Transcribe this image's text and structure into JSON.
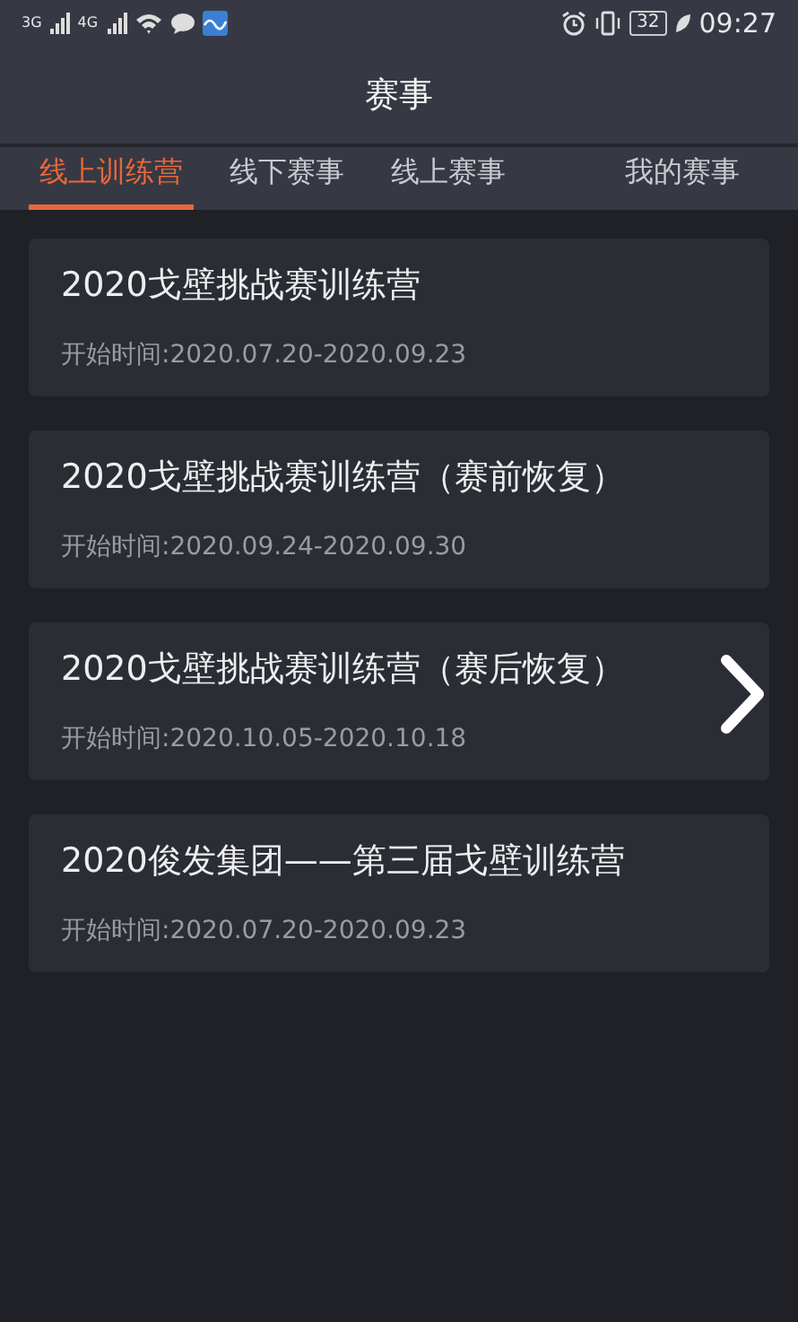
{
  "status_bar": {
    "network_1": "3G",
    "network_2": "4G",
    "battery": "32",
    "time": "09:27"
  },
  "header": {
    "title": "赛事"
  },
  "tabs": [
    {
      "label": "线上训练营",
      "selected": true
    },
    {
      "label": "线下赛事",
      "selected": false
    },
    {
      "label": "线上赛事",
      "selected": false
    },
    {
      "label": "我的赛事",
      "selected": false
    }
  ],
  "events": [
    {
      "title": "2020戈壁挑战赛训练营",
      "date": "开始时间:2020.07.20-2020.09.23",
      "arrow": false
    },
    {
      "title": "2020戈壁挑战赛训练营（赛前恢复）",
      "date": "开始时间:2020.09.24-2020.09.30",
      "arrow": false
    },
    {
      "title": "2020戈壁挑战赛训练营（赛后恢复）",
      "date": "开始时间:2020.10.05-2020.10.18",
      "arrow": true
    },
    {
      "title": "2020俊发集团——第三届戈壁训练营",
      "date": "开始时间:2020.07.20-2020.09.23",
      "arrow": false
    }
  ]
}
